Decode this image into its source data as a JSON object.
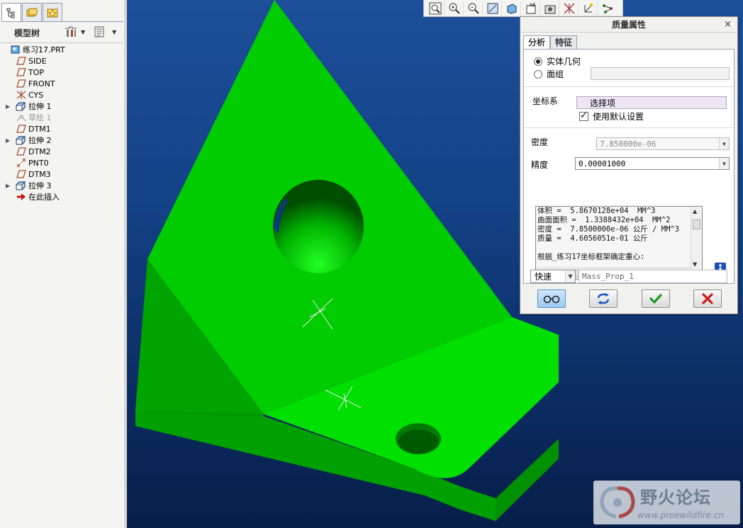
{
  "model_tree": {
    "header_title": "模型树",
    "items": [
      {
        "label": "练习17.PRT",
        "icon": "part-icon",
        "expander": ""
      },
      {
        "label": "SIDE",
        "icon": "datum-plane-icon",
        "expander": ""
      },
      {
        "label": "TOP",
        "icon": "datum-plane-icon",
        "expander": ""
      },
      {
        "label": "FRONT",
        "icon": "datum-plane-icon",
        "expander": ""
      },
      {
        "label": "CYS",
        "icon": "coordinate-system-icon",
        "expander": ""
      },
      {
        "label": "拉伸 1",
        "icon": "extrude-icon",
        "expander": "▶"
      },
      {
        "label": "草绘 1",
        "icon": "sketch-icon",
        "expander": "",
        "dim": true
      },
      {
        "label": "DTM1",
        "icon": "datum-plane-icon",
        "expander": ""
      },
      {
        "label": "拉伸 2",
        "icon": "extrude-icon",
        "expander": "▶"
      },
      {
        "label": "DTM2",
        "icon": "datum-plane-icon",
        "expander": ""
      },
      {
        "label": "PNT0",
        "icon": "datum-point-icon",
        "expander": ""
      },
      {
        "label": "DTM3",
        "icon": "datum-plane-icon",
        "expander": ""
      },
      {
        "label": "拉伸 3",
        "icon": "extrude-icon",
        "expander": "▶"
      },
      {
        "label": "在此插入",
        "icon": "insert-here-arrow-icon",
        "expander": ""
      }
    ]
  },
  "toolbar": {
    "buttons": [
      "zoom-fit-icon",
      "zoom-in-icon",
      "zoom-out-icon",
      "repaint-icon",
      "view-orient-icon",
      "saved-views-icon",
      "layers-icon",
      "datum-axis-toggle-icon",
      "coord-sys-toggle-icon",
      "datum-point-toggle-icon"
    ]
  },
  "dialog": {
    "title": "质量属性",
    "close": "×",
    "tabs": [
      "分析",
      "特征"
    ],
    "radio_solid": "实体几何",
    "radio_quilt": "面组",
    "coord_label": "坐标系",
    "select_item": "选择项",
    "use_default": "使用默认设置",
    "density_label": "密度",
    "density_value": "7.850000e-06",
    "accuracy_label": "精度",
    "accuracy_value": "0.00001000",
    "results_text": "体积 =  5.8670128e+04  MM^3\n曲面面积 =  1.3388432e+04  MM^2\n密度 =  7.8500000e-06 公斤 / MM^3\n质量 =  4.6056051e-01 公斤\n\n根据_练习17坐标框架确定重心:",
    "mode_value": "快速",
    "name_value": "Mass_Prop_1"
  },
  "watermark": {
    "title": "野火论坛",
    "url": "www.proewildfire.cn"
  },
  "colors": {
    "model_green": "#00cc00",
    "background_blue": "#134185"
  }
}
